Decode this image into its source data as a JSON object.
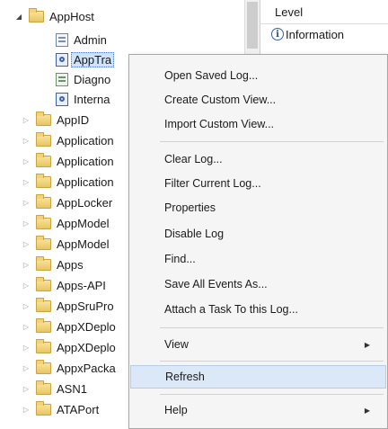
{
  "tree": {
    "items": [
      {
        "label": "AppHost",
        "icon": "folder",
        "expanded": true,
        "level": 0
      },
      {
        "label": "Admin",
        "icon": "log",
        "level": 1
      },
      {
        "label": "AppTra",
        "icon": "operational-log",
        "level": 1,
        "selected": true
      },
      {
        "label": "Diagno",
        "icon": "diagnostic-log",
        "level": 1
      },
      {
        "label": "Interna",
        "icon": "operational-log",
        "level": 1
      },
      {
        "label": "AppID",
        "icon": "folder",
        "level": 0
      },
      {
        "label": "Application",
        "icon": "folder",
        "level": 0
      },
      {
        "label": "Application",
        "icon": "folder",
        "level": 0
      },
      {
        "label": "Application",
        "icon": "folder",
        "level": 0
      },
      {
        "label": "AppLocker",
        "icon": "folder",
        "level": 0
      },
      {
        "label": "AppModel",
        "icon": "folder",
        "level": 0
      },
      {
        "label": "AppModel",
        "icon": "folder",
        "level": 0
      },
      {
        "label": "Apps",
        "icon": "folder",
        "level": 0
      },
      {
        "label": "Apps-API",
        "icon": "folder",
        "level": 0
      },
      {
        "label": "AppSruPro",
        "icon": "folder",
        "level": 0
      },
      {
        "label": "AppXDeplo",
        "icon": "folder",
        "level": 0
      },
      {
        "label": "AppXDeplo",
        "icon": "folder",
        "level": 0
      },
      {
        "label": "AppxPacka",
        "icon": "folder",
        "level": 0
      },
      {
        "label": "ASN1",
        "icon": "folder",
        "level": 0
      },
      {
        "label": "ATAPort",
        "icon": "folder",
        "level": 0
      }
    ]
  },
  "events": {
    "column_header": "Level",
    "rows": [
      {
        "label": "Information",
        "icon": "info-icon"
      }
    ]
  },
  "context_menu": {
    "items": [
      {
        "label": "Open Saved Log...",
        "group": 1
      },
      {
        "label": "Create Custom View...",
        "group": 1
      },
      {
        "label": "Import Custom View...",
        "group": 1
      },
      {
        "label": "Clear Log...",
        "group": 2
      },
      {
        "label": "Filter Current Log...",
        "group": 2
      },
      {
        "label": "Properties",
        "group": 2
      },
      {
        "label": "Disable Log",
        "group": 2
      },
      {
        "label": "Find...",
        "group": 2
      },
      {
        "label": "Save All Events As...",
        "group": 2
      },
      {
        "label": "Attach a Task To this Log...",
        "group": 2
      },
      {
        "label": "View",
        "group": 3,
        "submenu": true
      },
      {
        "label": "Refresh",
        "group": 4,
        "highlighted": true
      },
      {
        "label": "Help",
        "group": 5,
        "submenu": true
      }
    ]
  },
  "colors": {
    "selection": "#cfe3fb",
    "menu_highlight": "#dbe8f7",
    "menu_background": "#f5f5f5"
  }
}
